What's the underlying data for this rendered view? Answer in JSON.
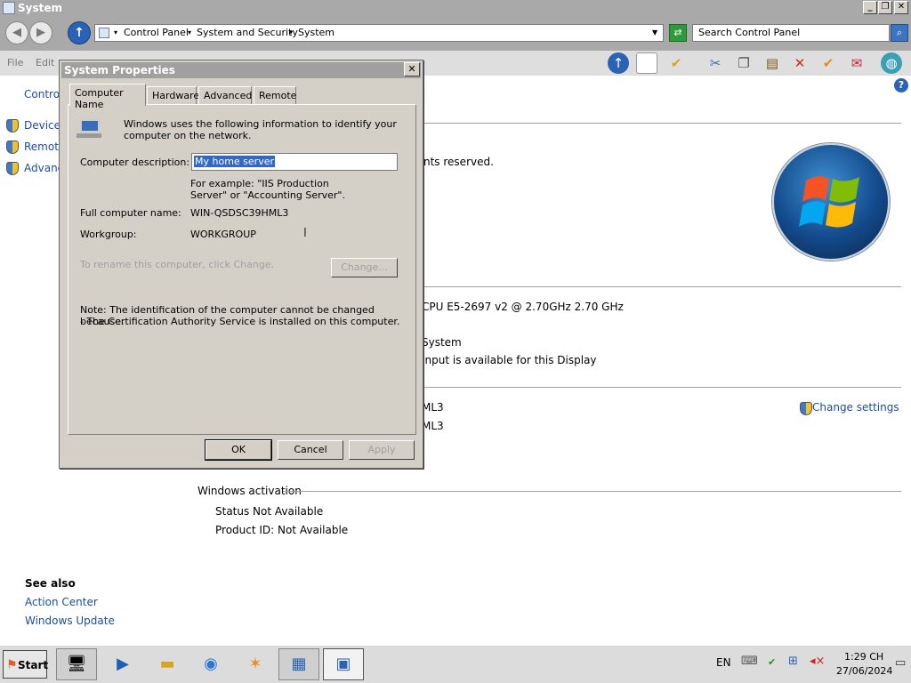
{
  "window": {
    "title": "System",
    "controls": {
      "minimize": "_",
      "maximize": "❐",
      "close": "✕"
    }
  },
  "address_bar": {
    "crumbs": [
      "Control Panel",
      "System and Security",
      "System"
    ],
    "separator": "▾",
    "search_placeholder": "Search Control Panel"
  },
  "menu": {
    "items": [
      "File",
      "Edit"
    ]
  },
  "left_panel": {
    "home_link": "Control",
    "links": [
      "Device M",
      "Remote",
      "Advance"
    ]
  },
  "main": {
    "copyright_fragment": "nts reserved.",
    "processor_fragment": "CPU E5-2697 v2 @ 2.70GHz   2.70 GHz",
    "system_type_fragment": "System",
    "pen_touch_fragment": "Input is available for this Display",
    "computer_name_fragment_1": "ML3",
    "computer_name_fragment_2": "ML3",
    "change_settings_label": "Change settings",
    "activation": {
      "heading": "Windows activation",
      "status": "Status Not Available",
      "product_id": "Product ID:  Not Available"
    },
    "see_also": {
      "heading": "See also",
      "links": [
        "Action Center",
        "Windows Update"
      ]
    }
  },
  "dialog": {
    "title": "System Properties",
    "close_label": "✕",
    "tabs": [
      "Computer Name",
      "Hardware",
      "Advanced",
      "Remote"
    ],
    "active_tab": "Computer Name",
    "intro": "Windows uses the following information to identify your computer on the network.",
    "description_label": "Computer description:",
    "description_value": "My home server",
    "example": "For example: \"IIS Production Server\" or \"Accounting Server\".",
    "full_name_label": "Full computer name:",
    "full_name_value": "WIN-QSDSC39HML3",
    "workgroup_label": "Workgroup:",
    "workgroup_value": "WORKGROUP",
    "rename_text": "To rename this computer, click Change.",
    "change_button": "Change...",
    "note_line1": "Note: The identification of the computer cannot be changed because:",
    "note_line2": "- The Certification Authority Service is installed on this computer.",
    "ok_button": "OK",
    "cancel_button": "Cancel",
    "apply_button": "Apply"
  },
  "taskbar": {
    "start_label": "Start",
    "language": "EN",
    "time": "1:29 CH",
    "date": "27/06/2024"
  },
  "colors": {
    "link": "#1a4d9e",
    "title_bar": "#a9a9a9",
    "dialog_face": "#d4d0c8",
    "selection": "#3169c6"
  }
}
